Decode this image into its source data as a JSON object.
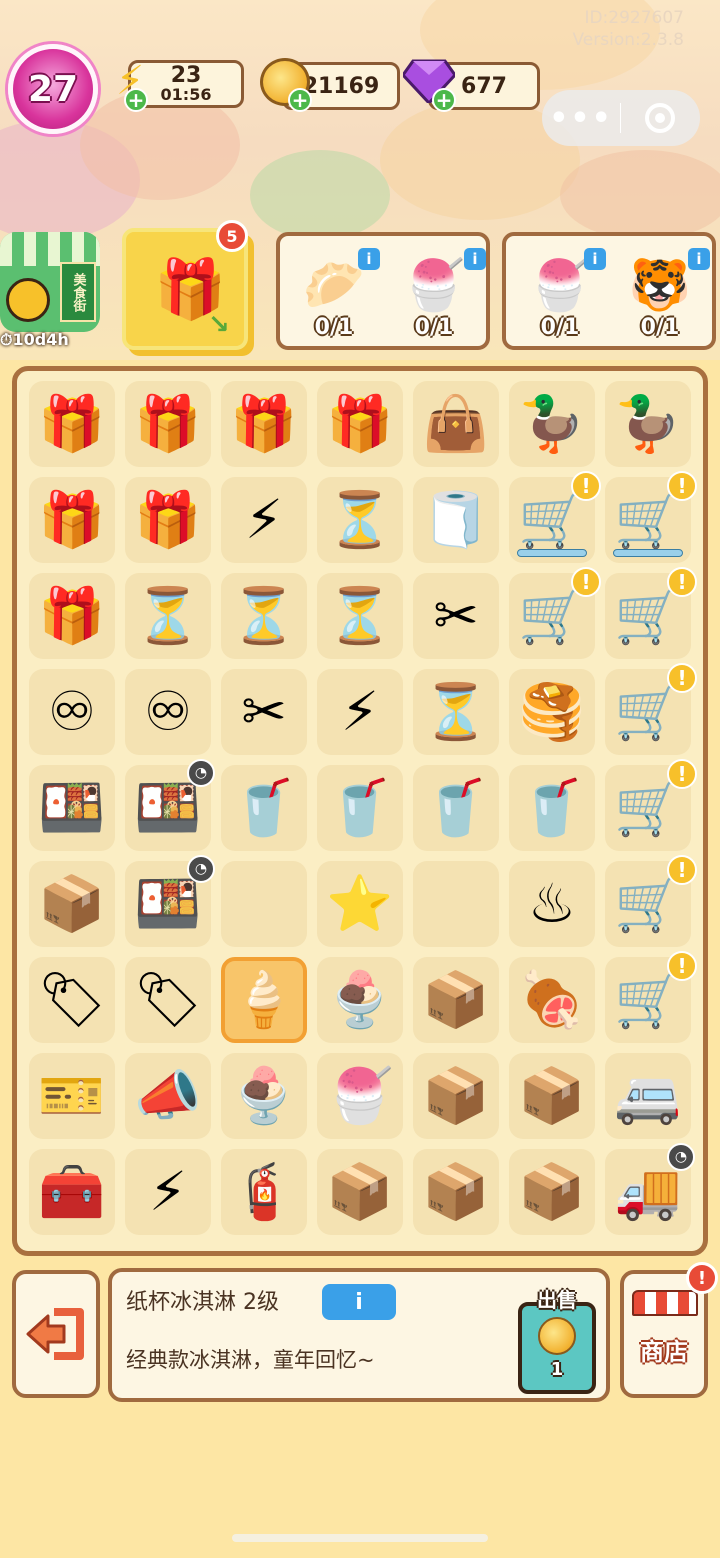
{
  "header": {
    "id_text": "ID:2927607",
    "version_text": "Version:2.3.8",
    "level": "27",
    "energy": {
      "value": "23",
      "timer": "01:56"
    },
    "coins": {
      "value": "21169"
    },
    "gems": {
      "value": "677"
    }
  },
  "side": {
    "shop_sign": "美食街",
    "timer": "10d4h",
    "gift_count": "5"
  },
  "orders": [
    {
      "items": [
        {
          "icon": "dough-icon",
          "glyph": "🥟",
          "count": "0/1"
        },
        {
          "icon": "shaved-ice-icon",
          "glyph": "🍧",
          "count": "0/1"
        }
      ]
    },
    {
      "items": [
        {
          "icon": "shaved-ice-icon",
          "glyph": "🍧",
          "count": "0/1"
        },
        {
          "icon": "tiger-customer-icon",
          "glyph": "🐯",
          "count": "0/1"
        }
      ]
    }
  ],
  "board": {
    "rows": [
      [
        "🎁",
        "🎁",
        "🎁",
        "🎁",
        "👜",
        "🦆",
        "🦆"
      ],
      [
        "🎁",
        "🎁",
        "⚡",
        "⏳",
        "🧻",
        "🛒",
        "🛒"
      ],
      [
        "🎁",
        "⏳",
        "⏳",
        "⏳",
        "✂",
        "🛒",
        "🛒"
      ],
      [
        "♾",
        "♾",
        "✂",
        "⚡",
        "⏳",
        "🥞",
        "🛒"
      ],
      [
        "🍱",
        "🍱",
        "🥤",
        "🥤",
        "🥤",
        "🥤",
        "🛒"
      ],
      [
        "📦",
        "🍱",
        "",
        "⭐",
        "",
        "♨",
        "🛒"
      ],
      [
        "🏷",
        "🏷",
        "🍦",
        "🍨",
        "📦",
        "🍖",
        "🛒"
      ],
      [
        "🎫",
        "📣",
        "🍨",
        "🍧",
        "📦",
        "📦",
        "🚐"
      ],
      [
        "🧰",
        "⚡",
        "🧯",
        "📦",
        "📦",
        "📦",
        "🚚"
      ]
    ],
    "icon_names": [
      [
        "gift-box-icon",
        "gift-box-icon",
        "gift-box-icon",
        "gift-box-icon",
        "bag-icon",
        "duck-mascot-icon",
        "duck-mascot-icon"
      ],
      [
        "gift-box-icon",
        "gift-box-icon",
        "energy-orb-icon",
        "hourglass-icon",
        "napkin-icon",
        "bbq-cart-icon",
        "food-cart-icon"
      ],
      [
        "gift-box-icon",
        "hourglass-icon",
        "hourglass-icon",
        "hourglass-icon",
        "scissors-icon",
        "bbq-cart-icon",
        "food-cart-icon"
      ],
      [
        "infinity-icon",
        "infinity-icon",
        "scissors-icon",
        "energy-orb-icon",
        "hourglass-icon",
        "pancake-basket-icon",
        "food-cart-icon"
      ],
      [
        "lunchbox-icon",
        "lunchbox-icon",
        "drink-cup-icon",
        "drink-cup-icon",
        "drink-cup-icon",
        "drink-cup-icon",
        "bbq-cart-icon"
      ],
      [
        "lunchbox-icon",
        "lunchbox-icon",
        "empty-cell",
        "starfish-icon",
        "empty-cell",
        "grill-icon",
        "bbq-cart-icon"
      ],
      [
        "poster-icon",
        "poster-icon",
        "ice-cream-cup-icon",
        "sundae-icon",
        "box-cart-icon",
        "grill-meat-icon",
        "bbq-cart-icon"
      ],
      [
        "ticket-icon",
        "megaphone-icon",
        "yogurt-icon",
        "shaved-ice-icon",
        "box-cart-icon",
        "box-cart-icon",
        "food-truck-icon"
      ],
      [
        "toolbox-icon",
        "energy-orb-icon",
        "gas-tank-icon",
        "box-cart-icon",
        "box-cart-icon",
        "box-cart-icon",
        "truck-icon"
      ]
    ],
    "selected": [
      6,
      2
    ]
  },
  "detail": {
    "title": "纸杯冰淇淋 2级",
    "info_label": "i",
    "description": "经典款冰淇淋，童年回忆~",
    "sell_label": "出售",
    "sell_price": "1"
  },
  "shop_button": {
    "label": "商店",
    "alert": "!"
  },
  "colors": {
    "accent": "#a06a3f",
    "info": "#3aa0e8",
    "level": "#d9349c",
    "sell": "#5cc7c2"
  }
}
